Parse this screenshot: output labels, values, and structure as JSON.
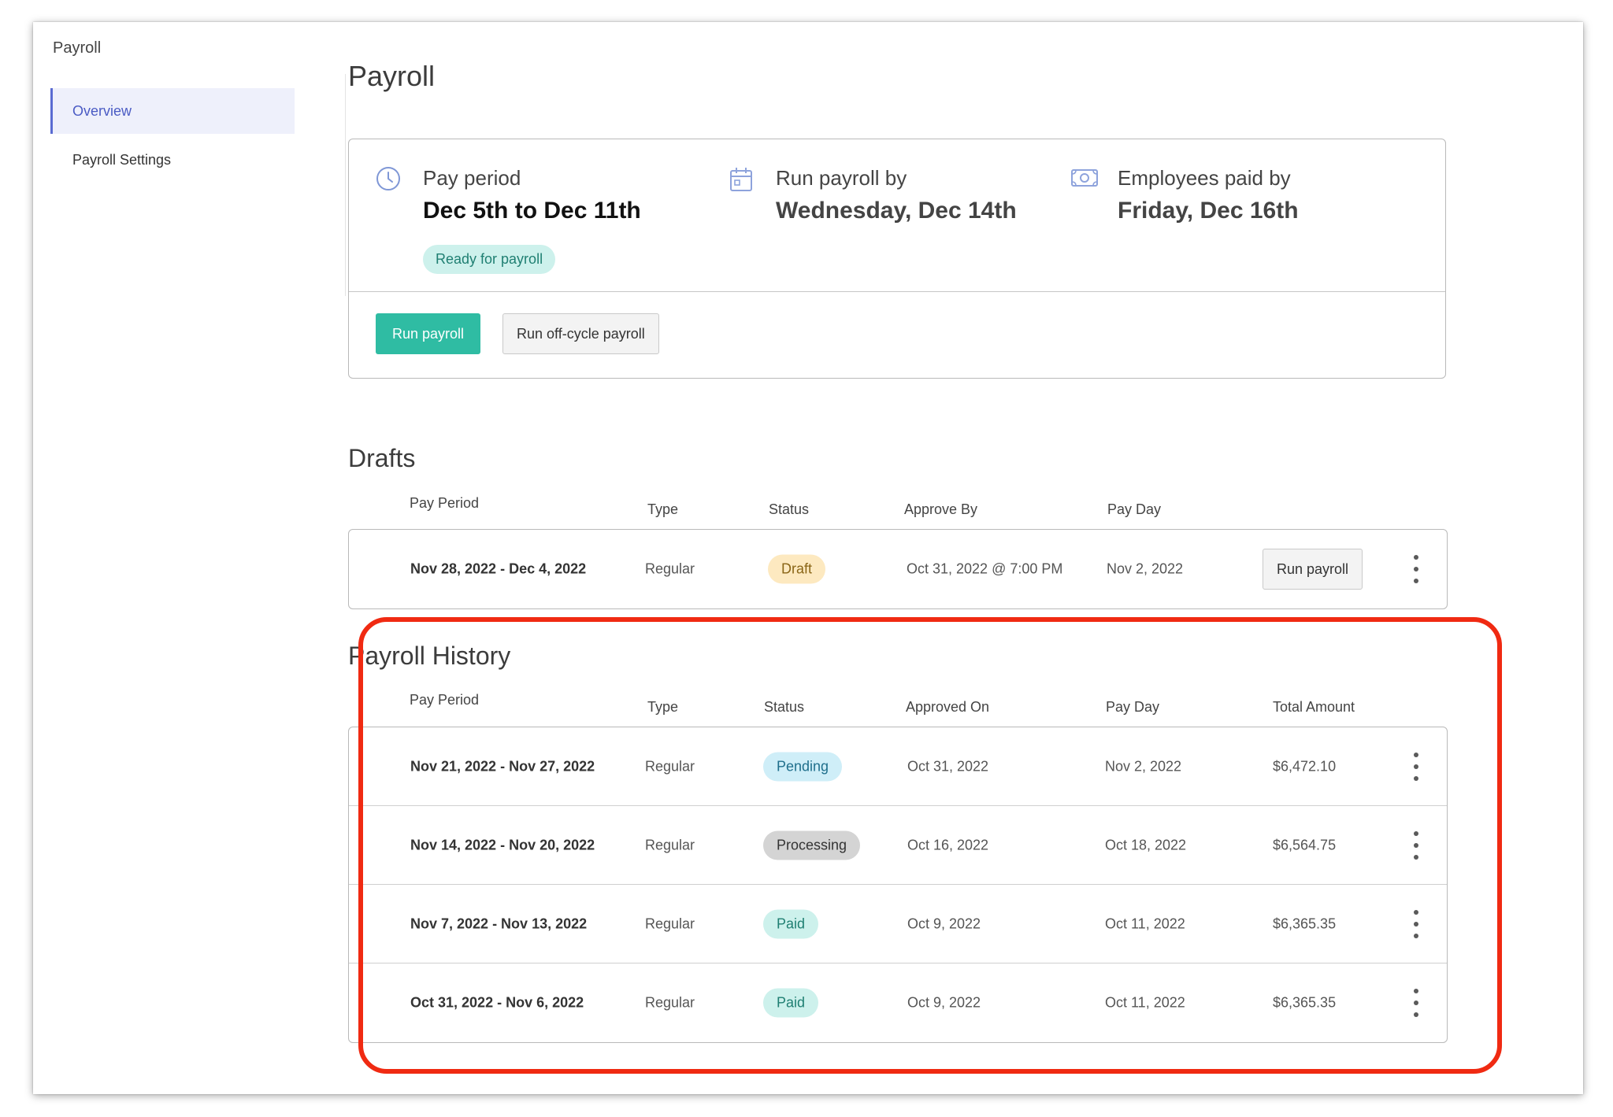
{
  "app": {
    "title": "Payroll"
  },
  "sidebar": {
    "items": [
      {
        "label": "Overview",
        "active": true
      },
      {
        "label": "Payroll Settings",
        "active": false
      }
    ]
  },
  "page": {
    "title": "Payroll"
  },
  "summary": {
    "pay_period": {
      "label": "Pay period",
      "value": "Dec 5th to Dec 11th",
      "badge": "Ready for payroll",
      "icon": "clock-icon"
    },
    "run_by": {
      "label": "Run payroll by",
      "value": "Wednesday, Dec 14th",
      "icon": "calendar-icon"
    },
    "paid_by": {
      "label": "Employees paid by",
      "value": "Friday, Dec 16th",
      "icon": "money-icon"
    },
    "actions": {
      "run_payroll": "Run payroll",
      "run_off_cycle": "Run off-cycle payroll"
    }
  },
  "drafts": {
    "title": "Drafts",
    "headers": {
      "pay_period": "Pay Period",
      "type": "Type",
      "status": "Status",
      "approve_by": "Approve By",
      "pay_day": "Pay Day"
    },
    "rows": [
      {
        "pay_period": "Nov 28, 2022 - Dec 4, 2022",
        "type": "Regular",
        "status": "Draft",
        "approve_by": "Oct 31, 2022 @ 7:00 PM",
        "pay_day": "Nov 2, 2022",
        "action": "Run payroll"
      }
    ]
  },
  "history": {
    "title": "Payroll History",
    "headers": {
      "pay_period": "Pay Period",
      "type": "Type",
      "status": "Status",
      "approved_on": "Approved On",
      "pay_day": "Pay Day",
      "total_amount": "Total Amount"
    },
    "rows": [
      {
        "pay_period": "Nov 21, 2022 - Nov 27, 2022",
        "type": "Regular",
        "status": "Pending",
        "approved_on": "Oct 31, 2022",
        "pay_day": "Nov 2, 2022",
        "total_amount": "$6,472.10"
      },
      {
        "pay_period": "Nov 14, 2022 - Nov 20, 2022",
        "type": "Regular",
        "status": "Processing",
        "approved_on": "Oct 16, 2022",
        "pay_day": "Oct 18, 2022",
        "total_amount": "$6,564.75"
      },
      {
        "pay_period": "Nov 7, 2022 - Nov 13, 2022",
        "type": "Regular",
        "status": "Paid",
        "approved_on": "Oct 9, 2022",
        "pay_day": "Oct 11, 2022",
        "total_amount": "$6,365.35"
      },
      {
        "pay_period": "Oct 31, 2022 - Nov 6, 2022",
        "type": "Regular",
        "status": "Paid",
        "approved_on": "Oct 9, 2022",
        "pay_day": "Oct 11, 2022",
        "total_amount": "$6,365.35"
      }
    ]
  },
  "colors": {
    "accent": "#2fbca3",
    "highlight_outline": "#f02a12",
    "nav_active": "#4a5bc4"
  }
}
